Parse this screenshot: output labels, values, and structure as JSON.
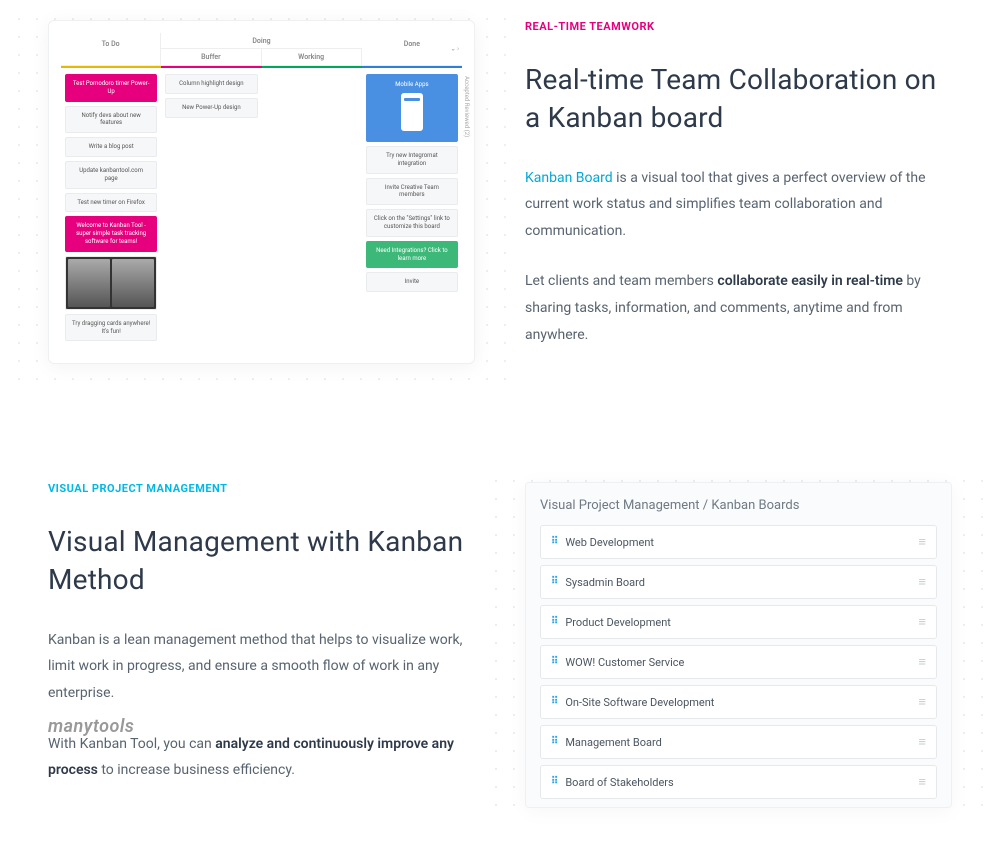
{
  "section1": {
    "eyebrow": "REAL-TIME TEAMWORK",
    "heading": "Real-time Team Collaboration on a Kanban board",
    "link_text": "Kanban Board",
    "p1_after_link": " is a visual tool that gives a perfect overview of the current work status and simplifies team collaboration and communication.",
    "p2_before": "Let clients and team members ",
    "p2_strong": "collaborate easily in real-time",
    "p2_after": " by sharing tasks, information, and comments, anytime and from anywhere."
  },
  "kanban": {
    "cols": {
      "todo": "To Do",
      "doing": "Doing",
      "buffer": "Buffer",
      "working": "Working",
      "done": "Done"
    },
    "side_label": "Accepted   Reviewed (2)",
    "col1": [
      "Test Pomodoro timer Power-Up",
      "Notify devs about new features",
      "Write a blog post",
      "Update kanbantool.com page",
      "Test new timer on Firefox",
      "Welcome to Kanban Tool - super simple task tracking software for teams!",
      "Try dragging cards anywhere! It's fun!"
    ],
    "col2": [
      "Column highlight design",
      "New Power-Up design"
    ],
    "col4": {
      "mobile_title": "Mobile Apps",
      "cards": [
        "Try new Integromat integration",
        "Invite Creative Team members",
        "Click on the \"Settings\" link to customize this board",
        "Need Integrations? Click to learn more",
        "Invite"
      ]
    }
  },
  "section2": {
    "eyebrow": "VISUAL PROJECT MANAGEMENT",
    "heading": "Visual Management with Kanban Method",
    "p1": "Kanban is a lean management method that helps to visualize work, limit work in progress, and ensure a smooth flow of work in any enterprise.",
    "p2_before": "With Kanban Tool, you can ",
    "p2_strong": "analyze and continuously improve any process",
    "p2_after": " to increase business efficiency."
  },
  "boards": {
    "title": "Visual Project Management / Kanban Boards",
    "items": [
      "Web Development",
      "Sysadmin Board",
      "Product Development",
      "WOW! Customer Service",
      "On-Site Software Development",
      "Management Board",
      "Board of Stakeholders"
    ]
  },
  "watermark": "manytools"
}
